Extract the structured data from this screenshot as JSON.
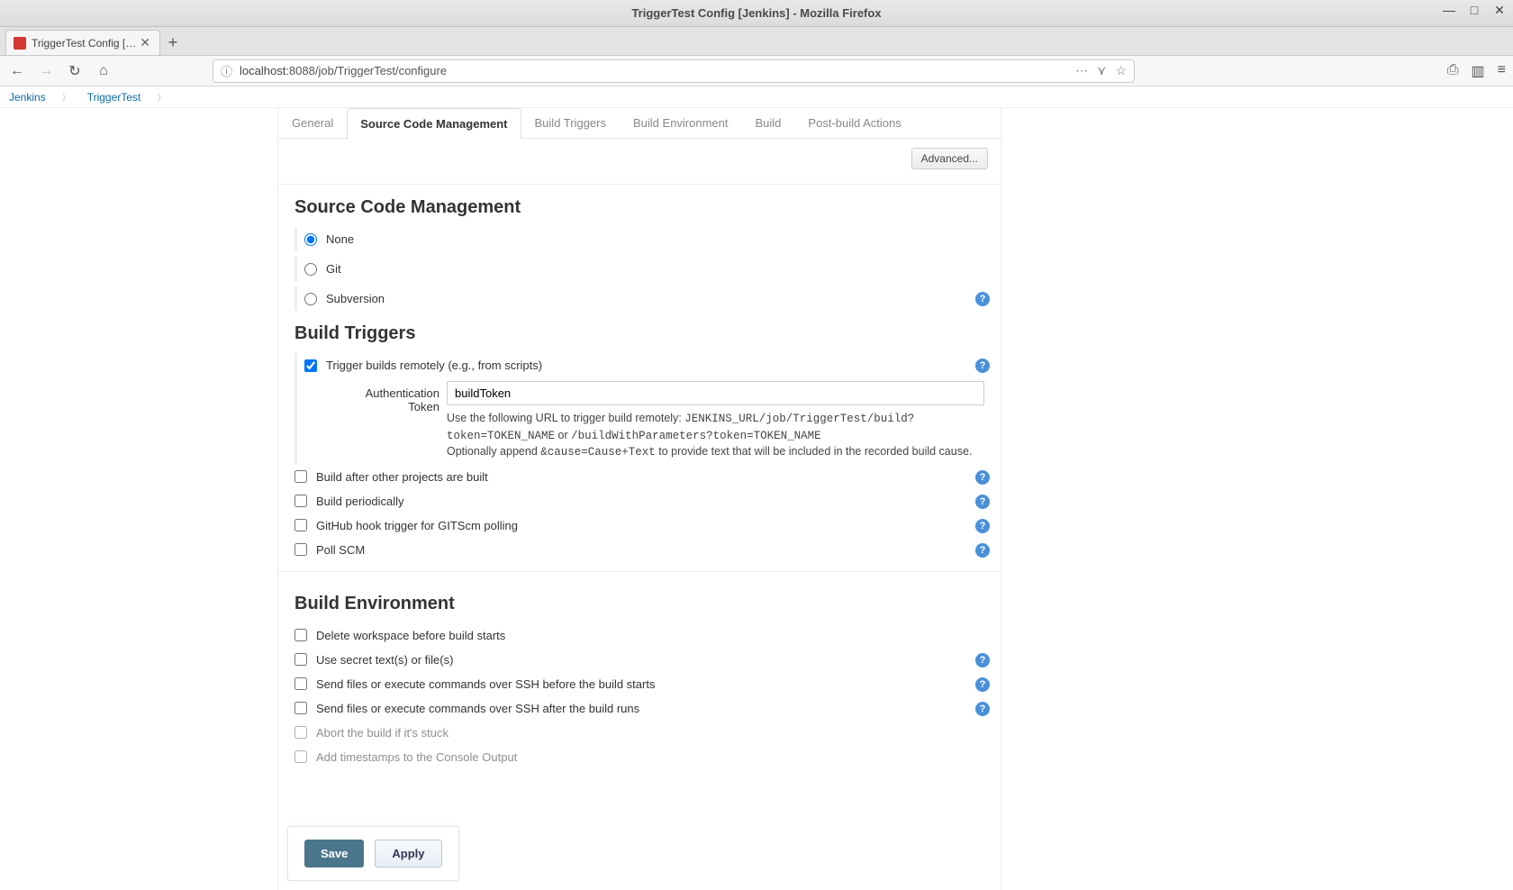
{
  "window": {
    "title": "TriggerTest Config [Jenkins] - Mozilla Firefox"
  },
  "browser_tab": {
    "title": "TriggerTest Config [Jenki"
  },
  "url": {
    "host": "localhost",
    "rest": ":8088/job/TriggerTest/configure"
  },
  "breadcrumbs": [
    "Jenkins",
    "TriggerTest"
  ],
  "cfg_tabs": [
    "General",
    "Source Code Management",
    "Build Triggers",
    "Build Environment",
    "Build",
    "Post-build Actions"
  ],
  "advanced_label": "Advanced...",
  "sections": {
    "scm": {
      "heading": "Source Code Management",
      "options": [
        {
          "label": "None",
          "checked": true
        },
        {
          "label": "Git",
          "checked": false
        },
        {
          "label": "Subversion",
          "checked": false,
          "help": true
        }
      ]
    },
    "triggers": {
      "heading": "Build Triggers",
      "remote": {
        "label": "Trigger builds remotely (e.g., from scripts)",
        "checked": true,
        "token_label": "Authentication Token",
        "token_value": "buildToken",
        "help1_a": "Use the following URL to trigger build remotely: ",
        "help1_b": "JENKINS_URL/job/TriggerTest/build?token=TOKEN_NAME",
        "help1_c": " or ",
        "help1_d": "/buildWithParameters?token=TOKEN_NAME",
        "help2_a": "Optionally append ",
        "help2_b": "&cause=Cause+Text",
        "help2_c": " to provide text that will be included in the recorded build cause."
      },
      "others": [
        {
          "label": "Build after other projects are built",
          "help": true
        },
        {
          "label": "Build periodically",
          "help": true
        },
        {
          "label": "GitHub hook trigger for GITScm polling",
          "help": true
        },
        {
          "label": "Poll SCM",
          "help": true
        }
      ]
    },
    "env": {
      "heading": "Build Environment",
      "options": [
        {
          "label": "Delete workspace before build starts"
        },
        {
          "label": "Use secret text(s) or file(s)",
          "help": true
        },
        {
          "label": "Send files or execute commands over SSH before the build starts",
          "help": true
        },
        {
          "label": "Send files or execute commands over SSH after the build runs",
          "help": true
        },
        {
          "label": "Abort the build if it's stuck",
          "faded": true
        },
        {
          "label": "Add timestamps to the Console Output",
          "faded": true
        }
      ]
    }
  },
  "buttons": {
    "save": "Save",
    "apply": "Apply"
  }
}
